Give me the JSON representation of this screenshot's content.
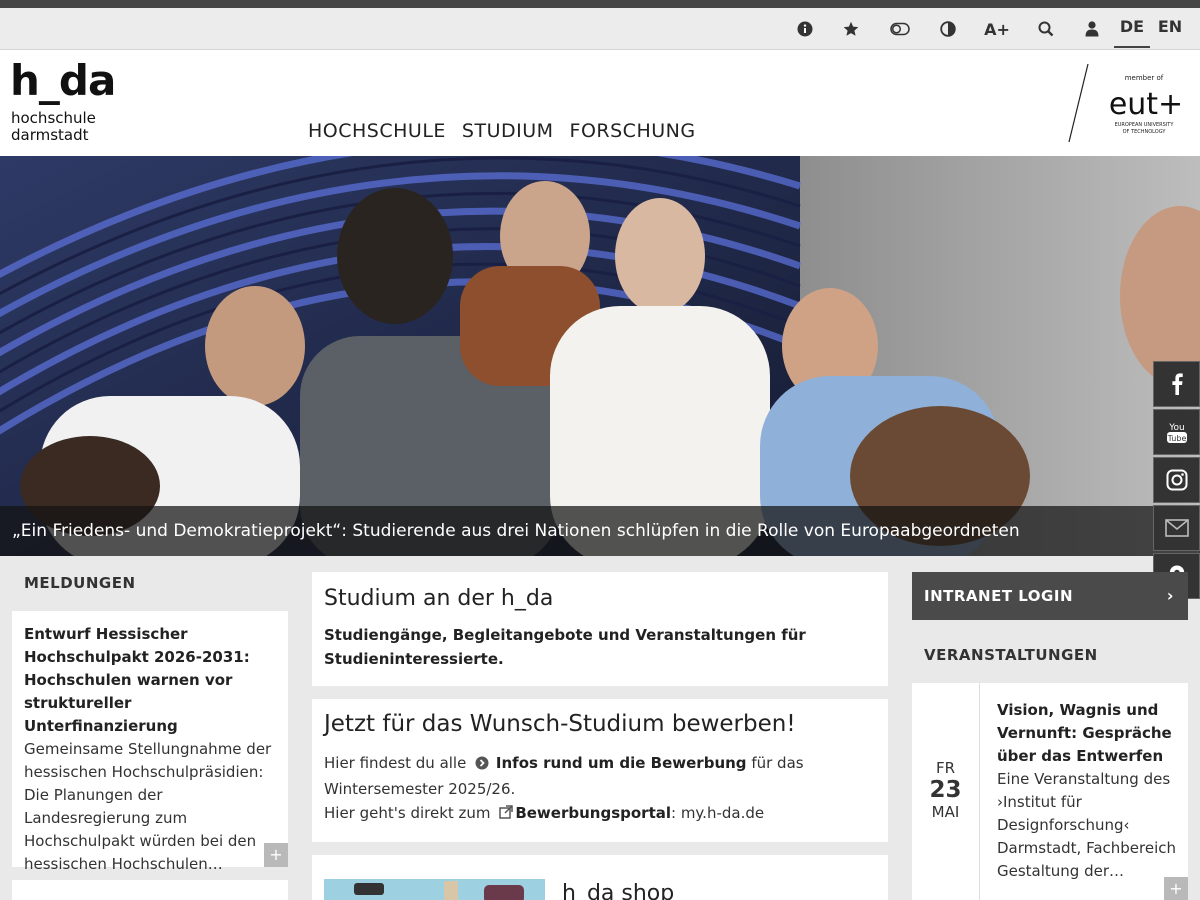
{
  "utility": {
    "icons": [
      "info-icon",
      "star-icon",
      "toggle-icon",
      "contrast-icon",
      "font-size-icon",
      "search-icon",
      "user-icon"
    ],
    "font_size_label": "A+",
    "languages": [
      {
        "label": "DE",
        "active": true
      },
      {
        "label": "EN",
        "active": false
      }
    ]
  },
  "logo": {
    "big": "h_da",
    "line1": "hochschule",
    "line2": "darmstadt"
  },
  "nav": {
    "items": [
      "HOCHSCHULE",
      "STUDIUM",
      "FORSCHUNG"
    ]
  },
  "eut": {
    "member": "member of",
    "mark": "eut+",
    "line1": "EUROPEAN UNIVERSITY",
    "line2": "OF TECHNOLOGY"
  },
  "hero": {
    "caption": "„Ein Friedens- und Demokratieprojekt“: Studierende aus drei Nationen schlüpfen in die Rolle von Europaabgeordneten"
  },
  "social": [
    "facebook-icon",
    "youtube-icon",
    "instagram-icon",
    "mail-icon",
    "location-icon"
  ],
  "meldungen": {
    "heading": "MELDUNGEN",
    "items": [
      {
        "title": "Entwurf Hessischer Hochschulpakt 2026-2031: Hochschulen warnen vor struktureller Unterfinanzierung",
        "text": "Gemeinsame Stellungnahme der hessischen Hochschulpräsidien: Die Planungen der Landesregierung zum Hochschulpakt würden bei den hessischen Hochschulen…"
      }
    ],
    "plus": "+"
  },
  "studium": {
    "title": "Studium an der h_da",
    "text": "Studiengänge, Begleitangebote und Veranstaltungen für Studieninteressierte."
  },
  "bewerben": {
    "title": "Jetzt für das Wunsch-Studium bewerben!",
    "line1_pre": "Hier findest du alle",
    "line1_link": "Infos rund um die Bewerbung",
    "line1_post": "für das",
    "line2": "Wintersemester 2025/26.",
    "line3_pre": "Hier geht's direkt zum",
    "line3_link": "Bewerbungsportal",
    "line3_post": ": my.h-da.de"
  },
  "shop": {
    "title": "h_da shop"
  },
  "intranet": {
    "label": "INTRANET LOGIN"
  },
  "veranstaltungen": {
    "heading": "VERANSTALTUNGEN",
    "event": {
      "weekday": "FR",
      "day": "23",
      "month": "MAI",
      "title": "Vision, Wagnis und Vernunft: Gespräche über das Entwerfen",
      "text": "Eine Veranstaltung des ›Institut für Designforschung‹ Darmstadt, Fachbereich Gestaltung der…"
    },
    "plus": "+"
  }
}
